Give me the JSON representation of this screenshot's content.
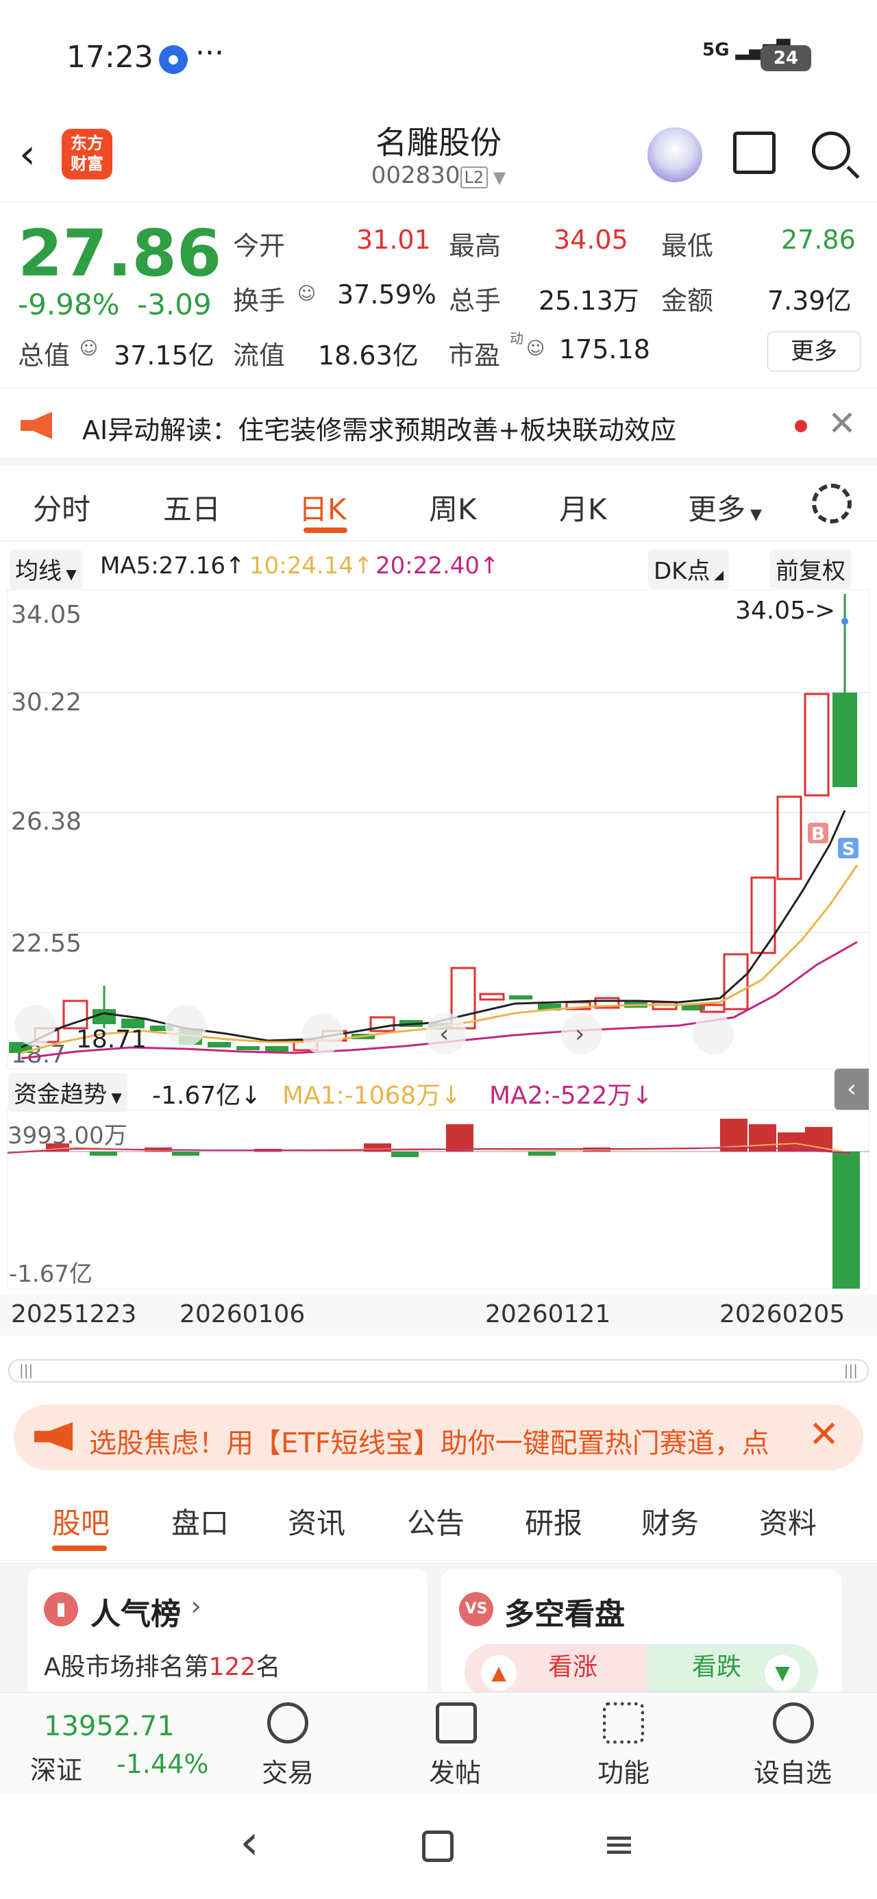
{
  "status_bar": {
    "time": "17:23",
    "dots": "···",
    "network": "5G",
    "battery": "24"
  },
  "header": {
    "name": "名雕股份",
    "code": "002830",
    "level": "L2"
  },
  "logo": {
    "line1": "东方",
    "line2": "财富"
  },
  "quote": {
    "price": "27.86",
    "change_pct": "-9.98%",
    "change_amt": "-3.09",
    "rows": [
      [
        {
          "k": "今开",
          "v": "31.01",
          "c": "red"
        },
        {
          "k": "最高",
          "v": "34.05",
          "c": "red"
        },
        {
          "k": "最低",
          "v": "27.86",
          "c": "green"
        }
      ],
      [
        {
          "k": "换手",
          "v": "37.59%",
          "c": "dark"
        },
        {
          "k": "总手",
          "v": "25.13万",
          "c": "dark"
        },
        {
          "k": "金额",
          "v": "7.39亿",
          "c": "dark"
        }
      ],
      [
        {
          "k": "总值",
          "v": "37.15亿",
          "c": "dark"
        },
        {
          "k": "流值",
          "v": "18.63亿",
          "c": "dark"
        },
        {
          "k": "市盈",
          "v": "175.18",
          "c": "dark"
        }
      ]
    ],
    "pe_sup": "动",
    "more": "更多"
  },
  "ai_banner": {
    "text": "AI异动解读：住宅装修需求预期改善+板块联动效应"
  },
  "tabs": [
    "分时",
    "五日",
    "日K",
    "周K",
    "月K",
    "更多"
  ],
  "ma": {
    "selector": "均线",
    "ma5": "MA5:27.16",
    "ma10": "10:24.14",
    "ma20": "20:22.40",
    "dk": "DK点",
    "adjust": "前复权"
  },
  "kchart": {
    "y_labels": [
      "34.05",
      "30.22",
      "26.38",
      "22.55",
      "18.7"
    ],
    "high_label": "34.05->",
    "low_label": "18.71",
    "marker_b": "B",
    "marker_s": "S"
  },
  "fund_flow": {
    "label": "资金趋势",
    "value": "-1.67亿",
    "ma1": "MA1:-1068万",
    "ma2": "MA2:-522万",
    "top": "3993.00万",
    "bottom": "-1.67亿"
  },
  "dates": [
    "20251223",
    "20260106",
    "20260121",
    "20260205"
  ],
  "promo": {
    "text": "选股焦虑！用【ETF短线宝】助你一键配置热门赛道，点"
  },
  "subtabs": [
    "股吧",
    "盘口",
    "资讯",
    "公告",
    "研报",
    "财务",
    "资料"
  ],
  "cards": {
    "popularity": {
      "title": "人气榜",
      "desc_prefix": "A股市场排名第",
      "rank": "122",
      "desc_suffix": "名"
    },
    "duokong": {
      "title": "多空看盘",
      "bull": "看涨",
      "bear": "看跌"
    }
  },
  "bottom_bar": {
    "index_value": "13952.71",
    "index_name": "深证",
    "index_change": "-1.44%",
    "items": [
      "交易",
      "发帖",
      "功能",
      "设自选"
    ]
  },
  "colors": {
    "up": "#e03131",
    "down": "#2f9e44",
    "accent": "#e8561c",
    "ma5": "#222222",
    "ma10": "#e9b44c",
    "ma20": "#c2267f"
  }
}
